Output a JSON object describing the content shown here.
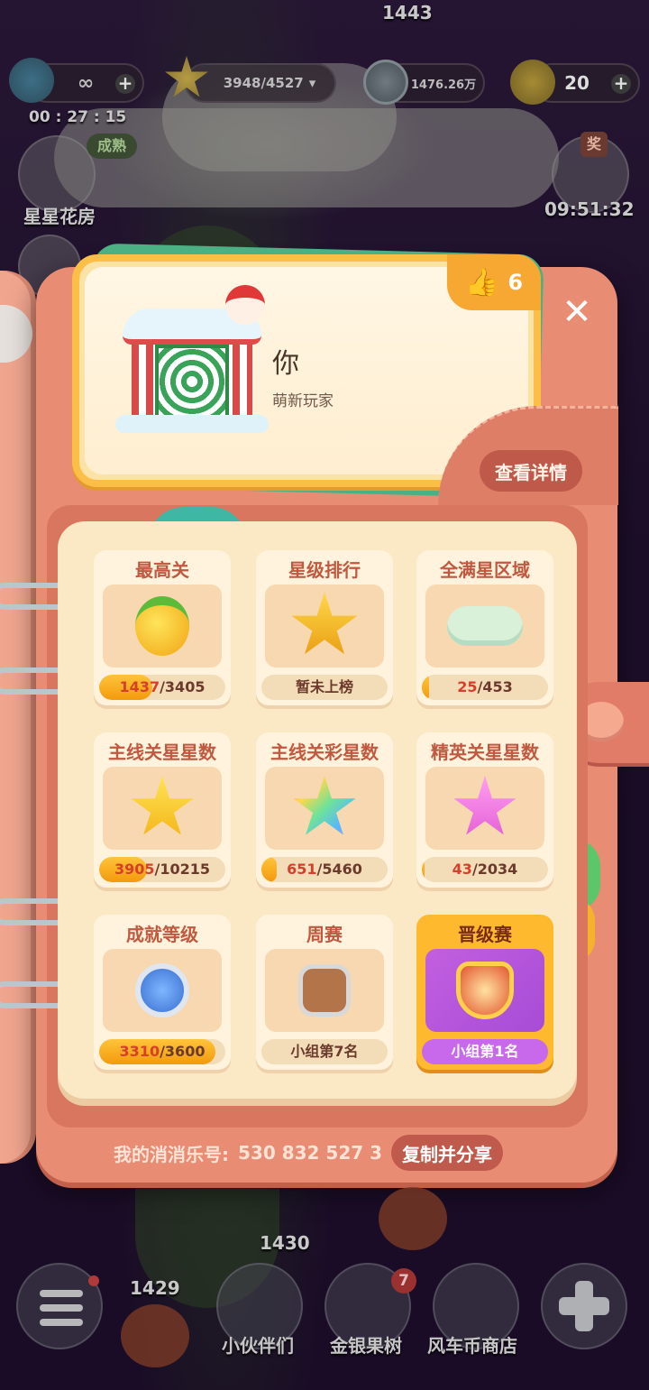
{
  "hud": {
    "top_level_number": "1443",
    "energy": {
      "value": "∞",
      "timer": "00 : 27 : 15"
    },
    "stars": {
      "value": "3948/4527"
    },
    "coins": {
      "value": "1476.26万"
    },
    "gold": {
      "value": "20"
    }
  },
  "side_left": {
    "flower_house_label": "星星花房",
    "flower_house_badge": "成熟"
  },
  "side_right": {
    "reward_badge": "奖",
    "timer": "09:51:32"
  },
  "profile": {
    "name": "你",
    "subtitle": "萌新玩家",
    "likes": "6",
    "detail_button": "查看详情"
  },
  "stats": [
    {
      "title": "最高关",
      "icon": "golden-fruit-icon",
      "value": "1437",
      "total": "/3405",
      "progress": 0.42,
      "type": "progress"
    },
    {
      "title": "星级排行",
      "icon": "star-trophy-icon",
      "text": "暂未上榜",
      "type": "text"
    },
    {
      "title": "全满星区域",
      "icon": "star-cloud-icon",
      "value": "25",
      "total": "/453",
      "progress": 0.055,
      "type": "progress"
    },
    {
      "title": "主线关星星数",
      "icon": "yellow-star-icon",
      "value": "3905",
      "total": "/10215",
      "progress": 0.38,
      "type": "progress"
    },
    {
      "title": "主线关彩星数",
      "icon": "rainbow-star-icon",
      "value": "651",
      "total": "/5460",
      "progress": 0.12,
      "type": "progress"
    },
    {
      "title": "精英关星星数",
      "icon": "pink-star-icon",
      "value": "43",
      "total": "/2034",
      "progress": 0.02,
      "type": "progress"
    },
    {
      "title": "成就等级",
      "icon": "medal-icon",
      "value": "3310",
      "total": "/3600",
      "progress": 0.92,
      "type": "progress"
    },
    {
      "title": "周赛",
      "icon": "cat-badge-icon",
      "text": "小组第7名",
      "type": "text"
    },
    {
      "title": "晋级赛",
      "icon": "winged-shield-icon",
      "text": "小组第1名",
      "type": "text",
      "highlight": true
    }
  ],
  "footer": {
    "id_label": "我的消消乐号:",
    "id_value": "530 832 527 3",
    "copy_button": "复制并分享"
  },
  "dock": {
    "level_left": "1429",
    "level_mid": "1430",
    "partners_label": "小伙伴们",
    "tree_label": "金银果树",
    "tree_badge": "7",
    "shop_label": "风车币商店"
  },
  "colors": {
    "accent_orange": "#fbbf48",
    "book_coral": "#e98c74",
    "title_red": "#c0593f",
    "progress_orange": "#f39a0d"
  }
}
